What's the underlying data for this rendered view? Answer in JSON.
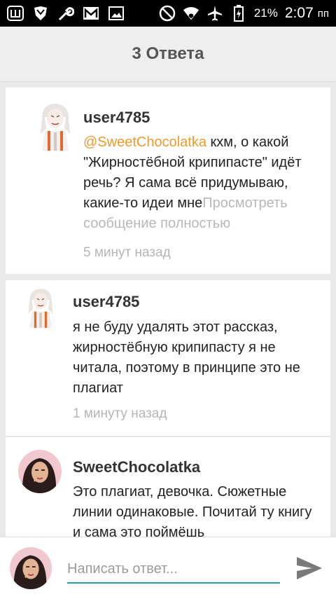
{
  "status_bar": {
    "battery": "21%",
    "time": "2:07",
    "time_suffix": "пп"
  },
  "header": {
    "title": "3 Ответа"
  },
  "comments": [
    {
      "user": "user4785",
      "mention": "@SweetChocolatka",
      "text": " кхм, о какой \"Жирностёбной крипипасте\" идёт речь? Я сама всё придумываю, какие-то идеи мне",
      "more": "Просмотреть сообщение полностью",
      "time": "5 минут назад"
    },
    {
      "user": "user4785",
      "text": "я не буду удалять этот рассказ, жирностёбную крипипасту я не читала, поэтому в принципе это не плагиат",
      "time": "1 минуту назад"
    },
    {
      "user": "SweetChocolatka",
      "text": "Это плагиат, девочка. Сюжетные линии одинаковые. Почитай ту книгу и сама это поймёшь"
    }
  ],
  "reply": {
    "placeholder": "Написать ответ..."
  },
  "colors": {
    "mention": "#f19a2a",
    "accent": "#2a9fb3"
  }
}
